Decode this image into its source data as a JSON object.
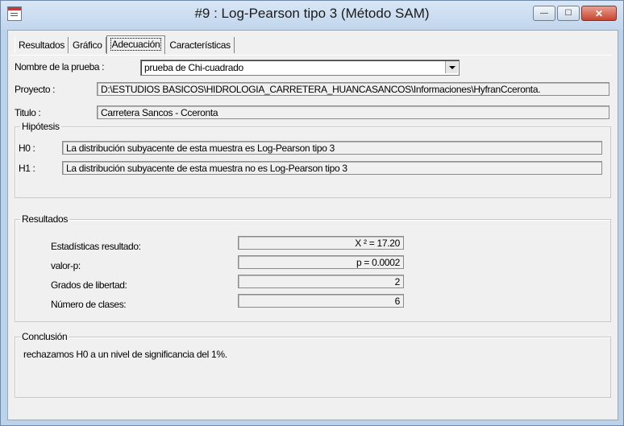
{
  "window": {
    "title": "#9 : Log-Pearson tipo 3 (Método SAM)",
    "buttons": {
      "minimize": "—",
      "maximize": "☐",
      "close": "✕"
    }
  },
  "tabs": [
    {
      "label": "Resultados"
    },
    {
      "label": "Gráfico"
    },
    {
      "label": "Adecuación",
      "active": true
    },
    {
      "label": "Características"
    }
  ],
  "test": {
    "label": "Nombre de la prueba :",
    "selected": "prueba de Chi-cuadrado"
  },
  "project": {
    "label": "Proyecto :",
    "value": "D:\\ESTUDIOS BASICOS\\HIDROLOGIA_CARRETERA_HUANCASANCOS\\Informaciones\\HyfranCceronta."
  },
  "title_field": {
    "label": "Titulo :",
    "value": "Carretera Sancos - Cceronta"
  },
  "hypothesis": {
    "group_label": "Hipótesis",
    "h0_label": "H0 :",
    "h0": "La distribución subyacente de esta muestra es Log-Pearson tipo 3",
    "h1_label": "H1 :",
    "h1": "La distribución subyacente de esta muestra no es Log-Pearson tipo 3"
  },
  "results": {
    "group_label": "Resultados",
    "rows": [
      {
        "label": "Estadísticas resultado:",
        "value": "X ² = 17.20"
      },
      {
        "label": "valor-p:",
        "value": "p = 0.0002"
      },
      {
        "label": "Grados de libertad:",
        "value": "2"
      },
      {
        "label": "Número de clases:",
        "value": "6"
      }
    ]
  },
  "conclusion": {
    "group_label": "Conclusión",
    "text": "rechazamos H0 a un nivel de significancia del 1%."
  },
  "colors": {
    "frame": "#bcd2ea",
    "panel": "#f0f0f0",
    "close": "#c7452f"
  }
}
